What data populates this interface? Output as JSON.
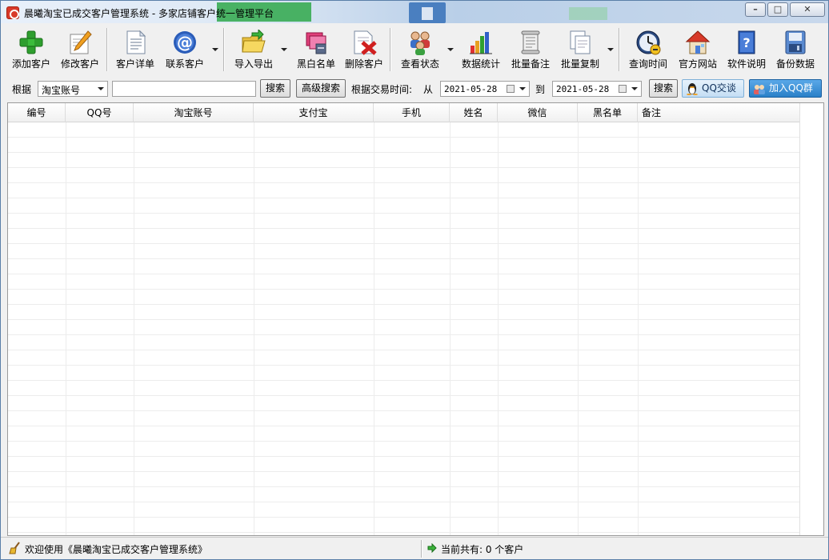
{
  "window": {
    "title": "晨曦淘宝已成交客户管理系统 - 多家店铺客户统一管理平台",
    "controls": [
      "minimize",
      "maximize",
      "close"
    ]
  },
  "toolbar": {
    "items": [
      {
        "label": "添加客户",
        "icon": "add-user-icon",
        "dropdown": false
      },
      {
        "label": "修改客户",
        "icon": "edit-icon",
        "dropdown": false
      },
      {
        "label": "客户详单",
        "icon": "document-icon",
        "dropdown": false
      },
      {
        "label": "联系客户",
        "icon": "at-icon",
        "dropdown": true
      },
      {
        "label": "导入导出",
        "icon": "folder-icon",
        "dropdown": true
      },
      {
        "label": "黑白名单",
        "icon": "list-icon",
        "dropdown": false
      },
      {
        "label": "删除客户",
        "icon": "delete-icon",
        "dropdown": false
      },
      {
        "label": "查看状态",
        "icon": "users-status-icon",
        "dropdown": true
      },
      {
        "label": "数据统计",
        "icon": "bar-chart-icon",
        "dropdown": false
      },
      {
        "label": "批量备注",
        "icon": "scroll-icon",
        "dropdown": false
      },
      {
        "label": "批量复制",
        "icon": "copy-icon",
        "dropdown": true
      },
      {
        "label": "查询时间",
        "icon": "clock-icon",
        "dropdown": false
      },
      {
        "label": "官方网站",
        "icon": "home-icon",
        "dropdown": false
      },
      {
        "label": "软件说明",
        "icon": "help-book-icon",
        "dropdown": false
      },
      {
        "label": "备份数据",
        "icon": "save-disk-icon",
        "dropdown": false
      }
    ]
  },
  "search": {
    "by_label": "根据",
    "field_selected": "淘宝账号",
    "keyword_value": "",
    "search_label": "搜索",
    "advanced_label": "高级搜索",
    "date_label": "根据交易时间:",
    "from_label": "从",
    "date_from": "2021-05-28",
    "to_label": "到",
    "date_to": "2021-05-28",
    "date_search_label": "搜索",
    "qq_chat_label": "QQ交谈",
    "join_qq_label": "加入QQ群"
  },
  "grid": {
    "columns": [
      "编号",
      "QQ号",
      "淘宝账号",
      "支付宝",
      "手机",
      "姓名",
      "微信",
      "黑名单",
      "备注"
    ],
    "rows": []
  },
  "status": {
    "welcome": "欢迎使用《晨曦淘宝已成交客户管理系统》",
    "count_text": "当前共有: 0 个客户"
  }
}
